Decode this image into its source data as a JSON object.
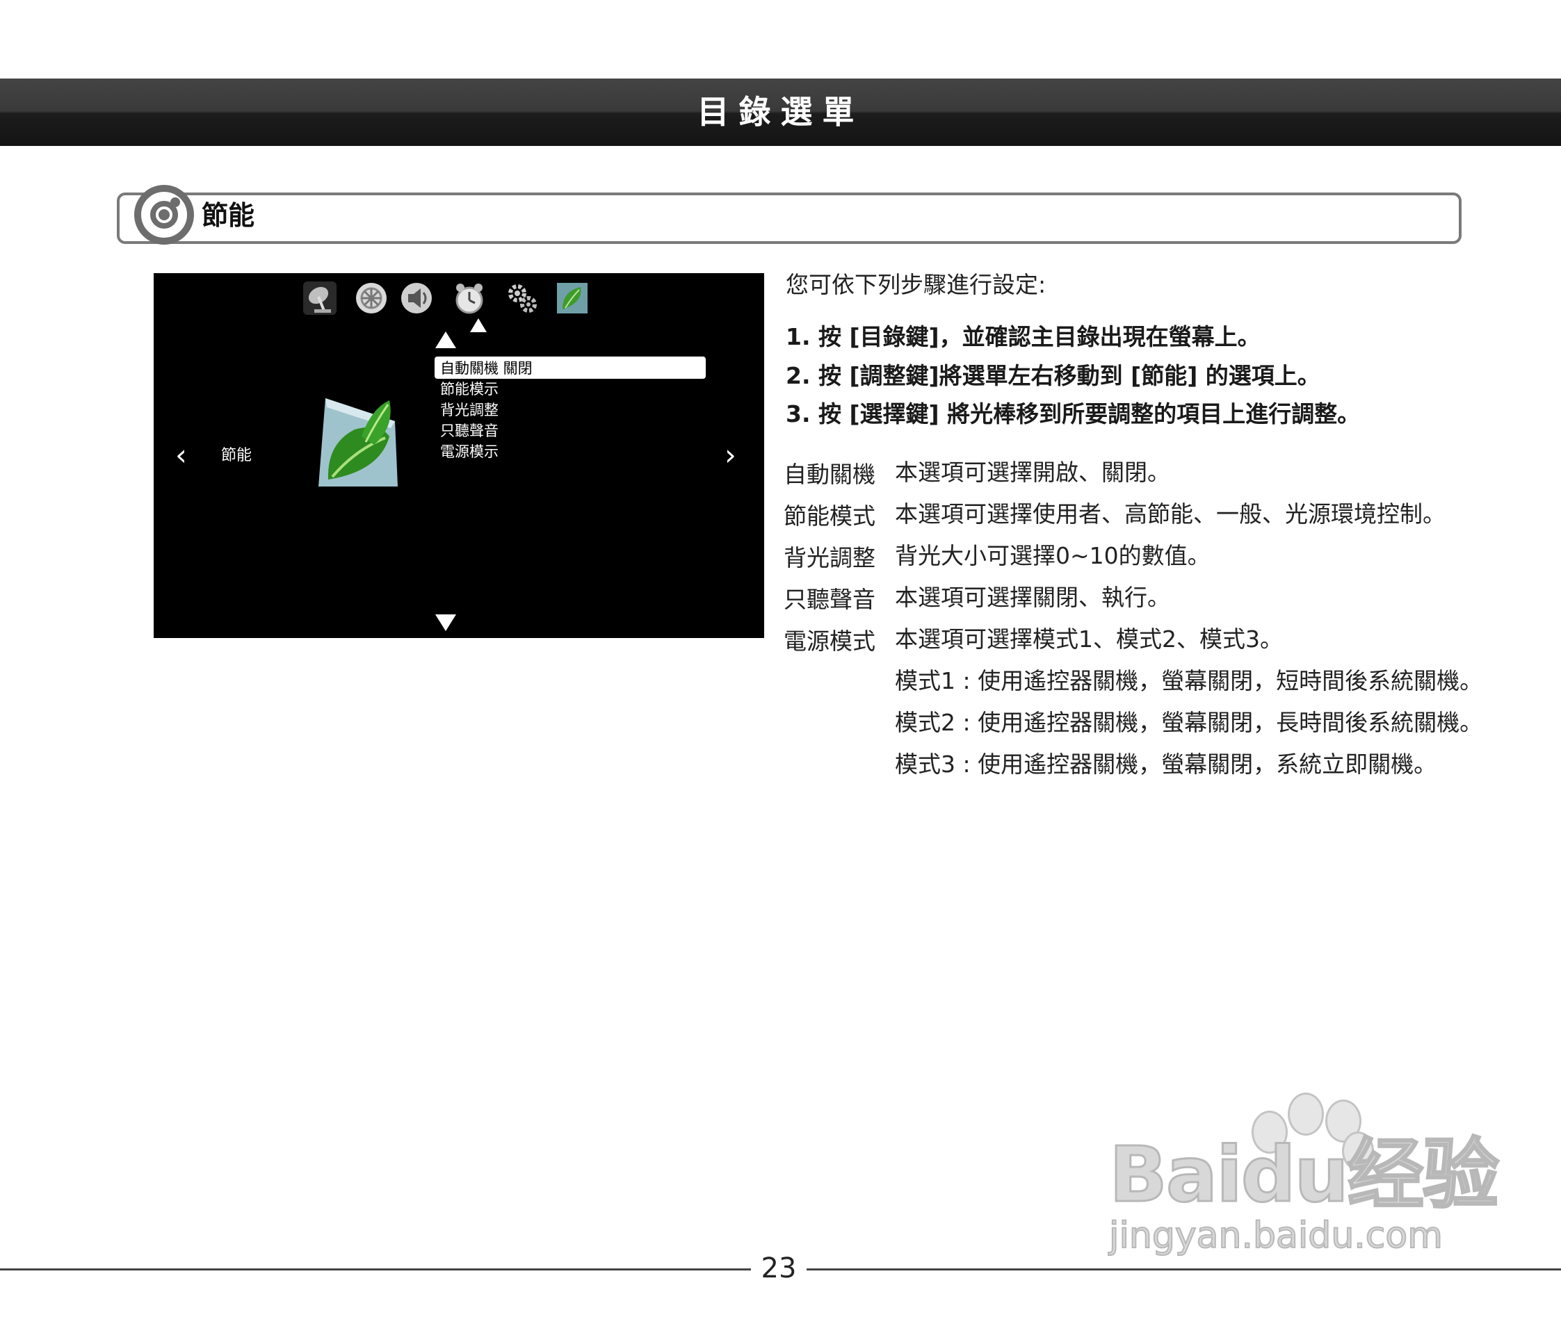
{
  "header": {
    "title": "目錄選單"
  },
  "section": {
    "title": "節能",
    "icon": "target-icon"
  },
  "tv_screen": {
    "top_icons": [
      "satellite-dish-icon",
      "picture-icon",
      "speaker-icon",
      "alarm-clock-icon",
      "gears-icon",
      "leaf-icon"
    ],
    "category_label": "節能",
    "menu_items": [
      {
        "label": "自動關機 關閉",
        "selected": true
      },
      {
        "label": "節能模示",
        "selected": false
      },
      {
        "label": "背光調整",
        "selected": false
      },
      {
        "label": "只聽聲音",
        "selected": false
      },
      {
        "label": "電源模示",
        "selected": false
      }
    ]
  },
  "instructions": {
    "intro": "您可依下列步驟進行設定:",
    "steps": [
      "1. 按 [目錄鍵]，並確認主目錄出現在螢幕上。",
      "2. 按 [調整鍵]將選單左右移動到 [節能] 的選項上。",
      "3. 按 [選擇鍵] 將光棒移到所要調整的項目上進行調整。"
    ],
    "definitions": [
      {
        "term": "自動關機",
        "desc": "本選項可選擇開啟、關閉。"
      },
      {
        "term": "節能模式",
        "desc": "本選項可選擇使用者、高節能、一般、光源環境控制。"
      },
      {
        "term": "背光調整",
        "desc": "背光大小可選擇0~10的數值。"
      },
      {
        "term": "只聽聲音",
        "desc": "本選項可選擇關閉、執行。"
      },
      {
        "term": "電源模式",
        "desc": "本選項可選擇模式1、模式2、模式3。"
      }
    ],
    "modes": [
      "模式1 : 使用遙控器關機，螢幕關閉，短時間後系統關機。",
      "模式2 : 使用遙控器關機，螢幕關閉，長時間後系統關機。",
      "模式3 : 使用遙控器關機，螢幕關閉，系統立即關機。"
    ]
  },
  "footer": {
    "page_number": "23"
  },
  "watermark": {
    "brand": "Baidu经验",
    "url": "jingyan.baidu.com"
  }
}
